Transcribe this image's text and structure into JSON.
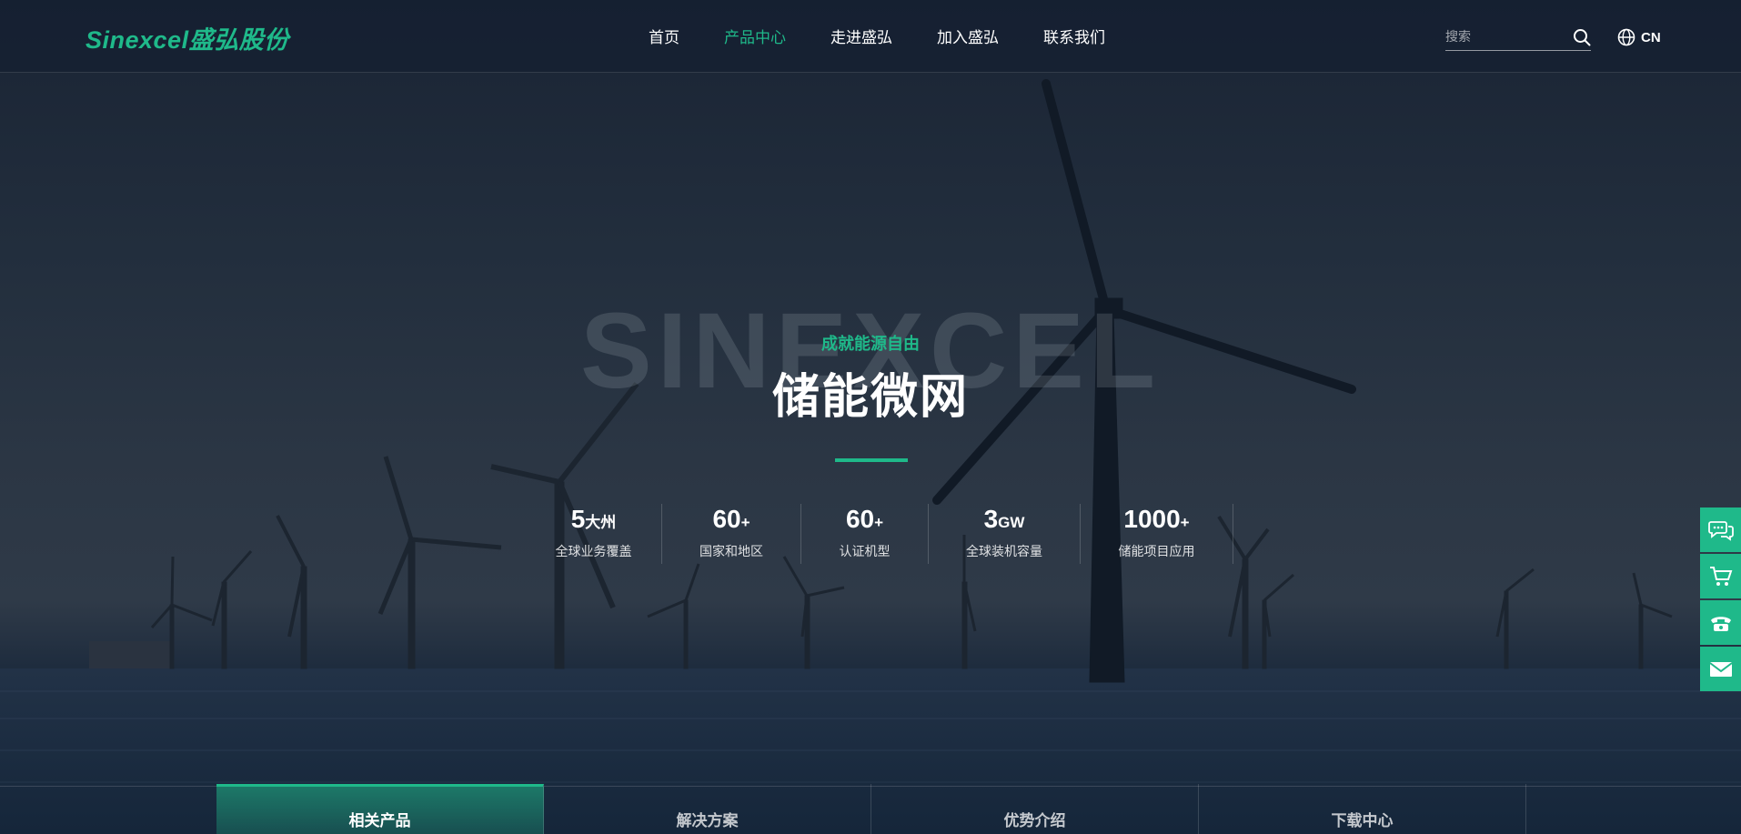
{
  "brand": {
    "logo_text": "Sinexcel盛弘股份",
    "accent_color": "#1fb98a"
  },
  "nav": {
    "items": [
      {
        "label": "首页",
        "active": false
      },
      {
        "label": "产品中心",
        "active": true
      },
      {
        "label": "走进盛弘",
        "active": false
      },
      {
        "label": "加入盛弘",
        "active": false
      },
      {
        "label": "联系我们",
        "active": false
      }
    ]
  },
  "search": {
    "placeholder": "搜索",
    "icon": "search-icon"
  },
  "language": {
    "label": "CN",
    "icon": "globe-icon"
  },
  "hero": {
    "watermark": "SINEXCEL",
    "subtitle": "成就能源自由",
    "title": "储能微网"
  },
  "stats": [
    {
      "value": "5",
      "unit": "大州",
      "label": "全球业务覆盖"
    },
    {
      "value": "60",
      "unit": "+",
      "label": "国家和地区"
    },
    {
      "value": "60",
      "unit": "+",
      "label": "认证机型"
    },
    {
      "value": "3",
      "unit": "GW",
      "label": "全球装机容量"
    },
    {
      "value": "1000",
      "unit": "+",
      "label": "储能项目应用"
    }
  ],
  "side_tools": [
    {
      "icon": "chat-icon"
    },
    {
      "icon": "cart-icon"
    },
    {
      "icon": "phone-icon"
    },
    {
      "icon": "mail-icon"
    }
  ],
  "tabs": [
    {
      "label": "相关产品",
      "active": true
    },
    {
      "label": "解决方案",
      "active": false
    },
    {
      "label": "优势介绍",
      "active": false
    },
    {
      "label": "下载中心",
      "active": false
    }
  ]
}
